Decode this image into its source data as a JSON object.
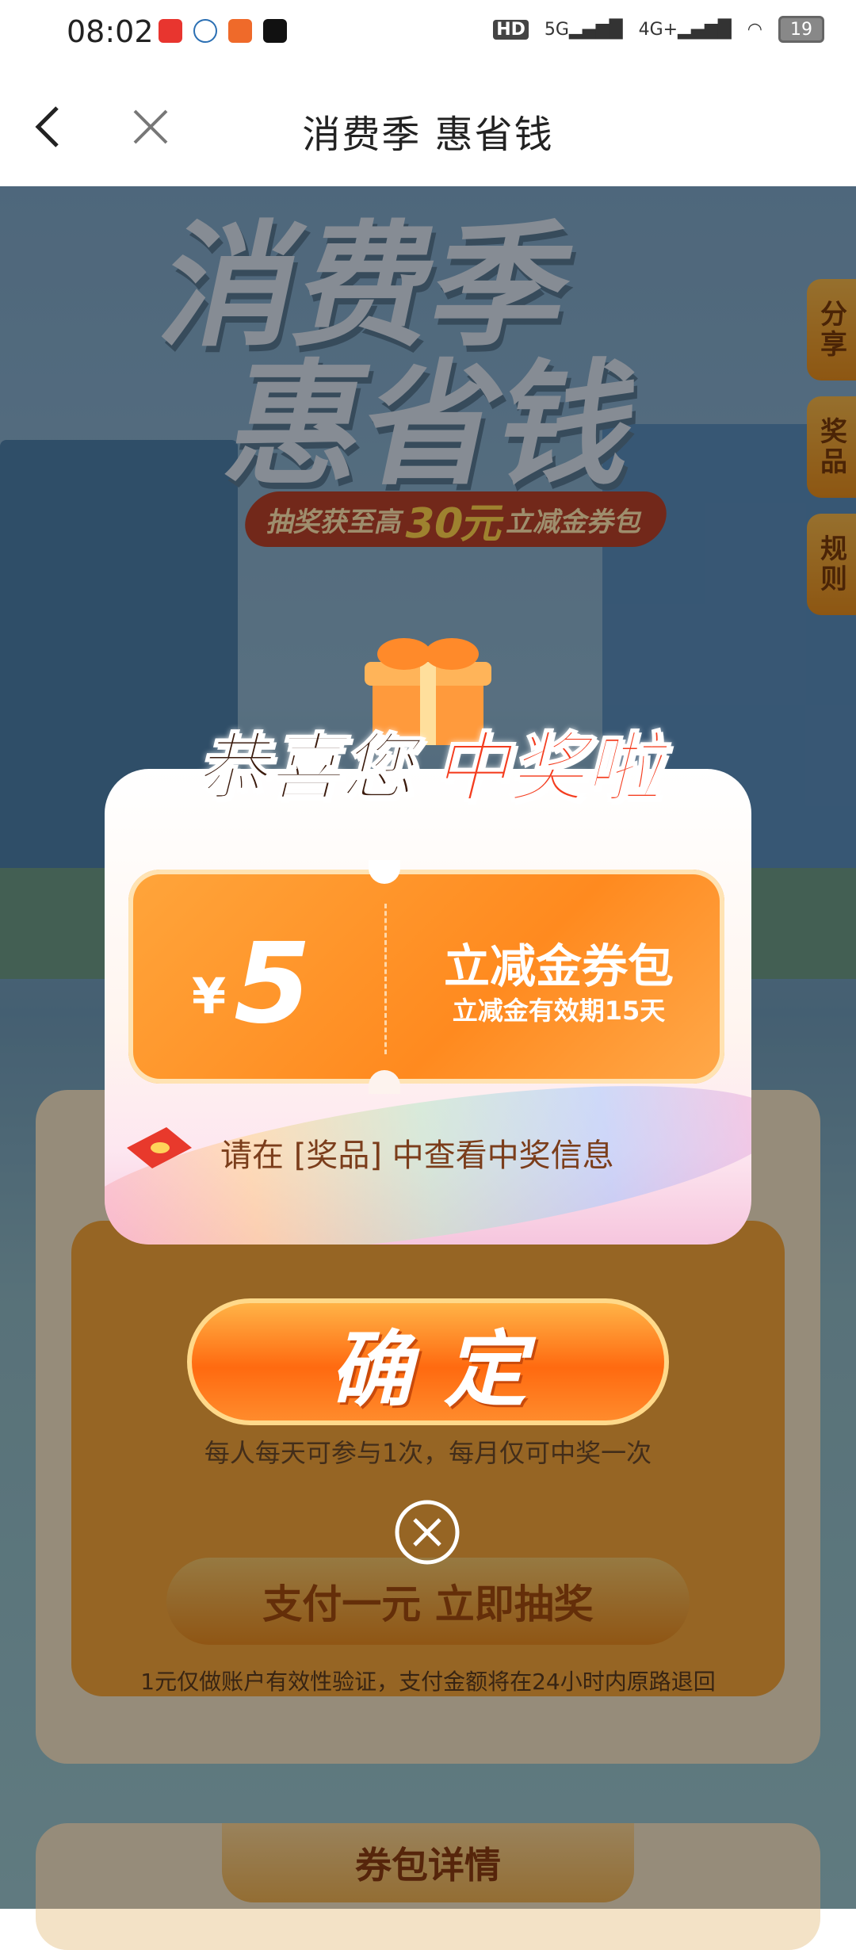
{
  "status_bar": {
    "time": "08:02",
    "signal_labels": [
      "HD",
      "5G",
      "4G+"
    ],
    "battery": "19",
    "app_icons": [
      "notification-app-1",
      "notification-app-2",
      "notification-app-3",
      "tiktok-icon"
    ]
  },
  "nav": {
    "title": "消费季 惠省钱",
    "back_icon": "chevron-left-icon",
    "close_icon": "close-icon"
  },
  "hero": {
    "title_line1": "消费季",
    "title_line2": "惠省钱",
    "subtitle_prefix": "抽奖获至高",
    "subtitle_amount": "30元",
    "subtitle_suffix": "立减金券包"
  },
  "side_tabs": [
    "分享",
    "奖品",
    "规则"
  ],
  "background": {
    "rule_text": "每人每天可参与1次，每月仅可中奖一次",
    "draw_button": "支付一元 立即抽奖",
    "verify_note": "1元仅做账户有效性验证，支付金额将在24小时内原路退回",
    "detail_tab": "券包详情"
  },
  "popup": {
    "congrats_part1": "恭喜您",
    "congrats_part2": "中奖啦",
    "coupon": {
      "currency": "¥",
      "amount": "5",
      "name": "立减金券包",
      "validity": "立减金有效期15天"
    },
    "notice": "请在 [奖品] 中查看中奖信息",
    "confirm_button": "确定"
  },
  "colors": {
    "accent_orange": "#ff8a1f",
    "title_red": "#f43d1f",
    "notice_brown": "#7b3d1b"
  }
}
